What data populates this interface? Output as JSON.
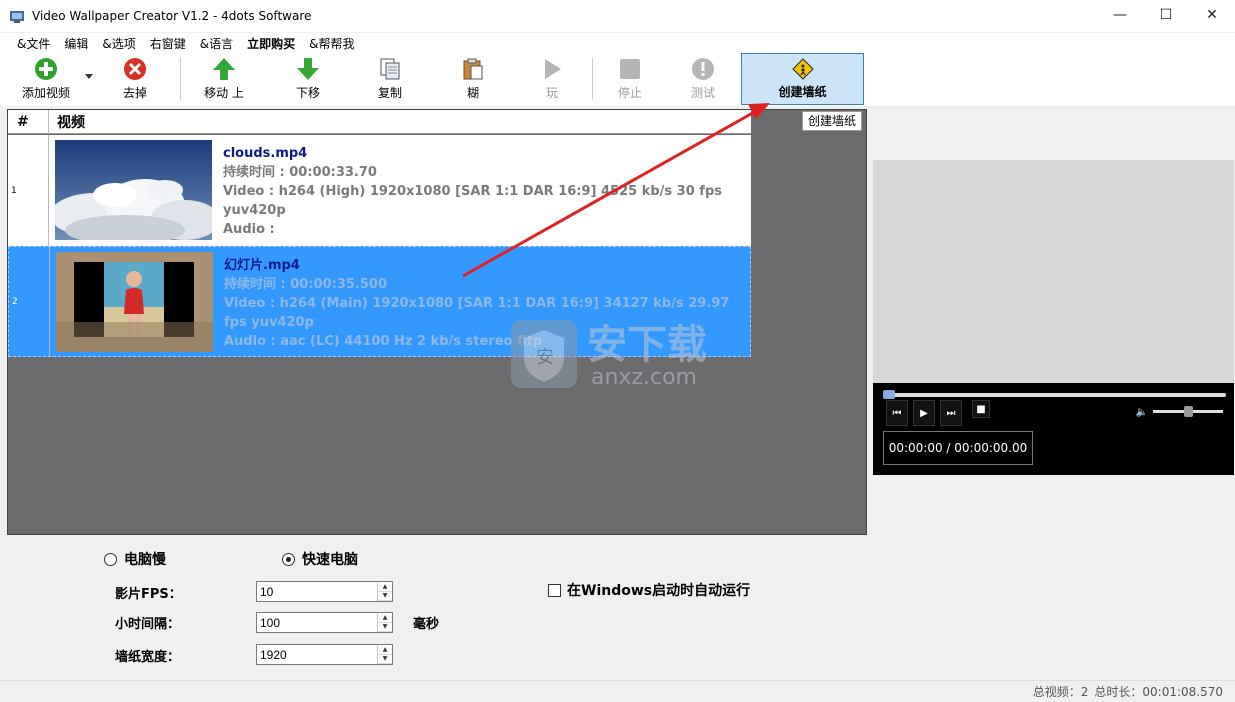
{
  "window": {
    "title": "Video Wallpaper Creator V1.2 - 4dots Software",
    "minimize": "—",
    "maximize": "☐",
    "close": "✕"
  },
  "menu": [
    "&文件",
    "编辑",
    "&选项",
    "右窗键",
    "&语言",
    "立即购买",
    "&帮帮我"
  ],
  "toolbar": {
    "add_video": "添加视频",
    "remove": "去掉",
    "move_up": "移动 上",
    "move_down": "下移",
    "copy": "复制",
    "paste": "糊",
    "play": "玩",
    "stop": "停止",
    "test": "测试",
    "create_wallpaper": "创建墙纸"
  },
  "list": {
    "col_hash": "#",
    "col_video": "视频",
    "tooltip": "创建墙纸",
    "rows": [
      {
        "num": "1",
        "name": "clouds.mp4",
        "duration": "持续时间 : 00:00:33.70",
        "video": "Video : h264 (High) 1920x1080 [SAR 1:1 DAR 16:9] 4525 kb/s 30 fps yuv420p",
        "audio": "Audio :"
      },
      {
        "num": "2",
        "name": "幻灯片.mp4",
        "duration": "持续时间 : 00:00:35.500",
        "video": "Video : h264 (Main) 1920x1080 [SAR 1:1 DAR 16:9] 34127 kb/s 29.97 fps yuv420p",
        "audio": "Audio : aac (LC) 44100 Hz 2 kb/s stereo fltp"
      }
    ]
  },
  "player": {
    "time": "00:00:00 / 00:00:00.00",
    "seek_fraction": 0,
    "volume_fraction": 0.5
  },
  "options": {
    "radio_slow": "电脑慢",
    "radio_fast": "快速电脑",
    "selected": "fast",
    "fps_label": "影片FPS：",
    "fps_value": "10",
    "interval_label": "小时间隔：",
    "interval_value": "100",
    "interval_unit": "毫秒",
    "width_label": "墙纸宽度：",
    "width_value": "1920",
    "autorun_label": "在Windows启动时自动运行",
    "autorun_checked": false
  },
  "watermark": {
    "text": "安下载",
    "sub": "anxz.com"
  },
  "status": {
    "total_videos": "总视频：2",
    "total_duration": "总时长：00:01:08.570"
  },
  "colors": {
    "selected_row": "#3399ff",
    "list_bg": "#6b6a6c",
    "create_btn_bg": "#cce4f7",
    "arrow": "#e02020"
  }
}
